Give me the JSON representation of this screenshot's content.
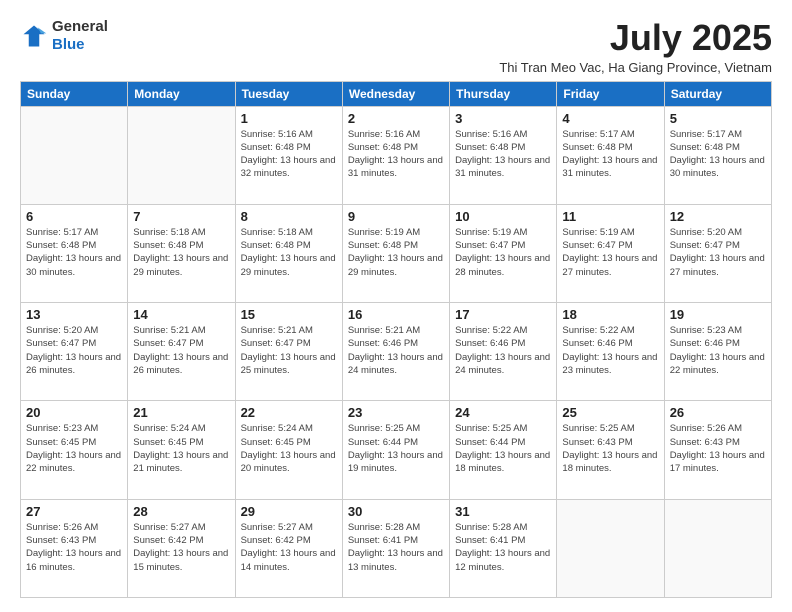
{
  "header": {
    "logo_line1": "General",
    "logo_line2": "Blue",
    "month_title": "July 2025",
    "location": "Thi Tran Meo Vac, Ha Giang Province, Vietnam"
  },
  "days_of_week": [
    "Sunday",
    "Monday",
    "Tuesday",
    "Wednesday",
    "Thursday",
    "Friday",
    "Saturday"
  ],
  "weeks": [
    [
      {
        "day": "",
        "info": ""
      },
      {
        "day": "",
        "info": ""
      },
      {
        "day": "1",
        "info": "Sunrise: 5:16 AM\nSunset: 6:48 PM\nDaylight: 13 hours and 32 minutes."
      },
      {
        "day": "2",
        "info": "Sunrise: 5:16 AM\nSunset: 6:48 PM\nDaylight: 13 hours and 31 minutes."
      },
      {
        "day": "3",
        "info": "Sunrise: 5:16 AM\nSunset: 6:48 PM\nDaylight: 13 hours and 31 minutes."
      },
      {
        "day": "4",
        "info": "Sunrise: 5:17 AM\nSunset: 6:48 PM\nDaylight: 13 hours and 31 minutes."
      },
      {
        "day": "5",
        "info": "Sunrise: 5:17 AM\nSunset: 6:48 PM\nDaylight: 13 hours and 30 minutes."
      }
    ],
    [
      {
        "day": "6",
        "info": "Sunrise: 5:17 AM\nSunset: 6:48 PM\nDaylight: 13 hours and 30 minutes."
      },
      {
        "day": "7",
        "info": "Sunrise: 5:18 AM\nSunset: 6:48 PM\nDaylight: 13 hours and 29 minutes."
      },
      {
        "day": "8",
        "info": "Sunrise: 5:18 AM\nSunset: 6:48 PM\nDaylight: 13 hours and 29 minutes."
      },
      {
        "day": "9",
        "info": "Sunrise: 5:19 AM\nSunset: 6:48 PM\nDaylight: 13 hours and 29 minutes."
      },
      {
        "day": "10",
        "info": "Sunrise: 5:19 AM\nSunset: 6:47 PM\nDaylight: 13 hours and 28 minutes."
      },
      {
        "day": "11",
        "info": "Sunrise: 5:19 AM\nSunset: 6:47 PM\nDaylight: 13 hours and 27 minutes."
      },
      {
        "day": "12",
        "info": "Sunrise: 5:20 AM\nSunset: 6:47 PM\nDaylight: 13 hours and 27 minutes."
      }
    ],
    [
      {
        "day": "13",
        "info": "Sunrise: 5:20 AM\nSunset: 6:47 PM\nDaylight: 13 hours and 26 minutes."
      },
      {
        "day": "14",
        "info": "Sunrise: 5:21 AM\nSunset: 6:47 PM\nDaylight: 13 hours and 26 minutes."
      },
      {
        "day": "15",
        "info": "Sunrise: 5:21 AM\nSunset: 6:47 PM\nDaylight: 13 hours and 25 minutes."
      },
      {
        "day": "16",
        "info": "Sunrise: 5:21 AM\nSunset: 6:46 PM\nDaylight: 13 hours and 24 minutes."
      },
      {
        "day": "17",
        "info": "Sunrise: 5:22 AM\nSunset: 6:46 PM\nDaylight: 13 hours and 24 minutes."
      },
      {
        "day": "18",
        "info": "Sunrise: 5:22 AM\nSunset: 6:46 PM\nDaylight: 13 hours and 23 minutes."
      },
      {
        "day": "19",
        "info": "Sunrise: 5:23 AM\nSunset: 6:46 PM\nDaylight: 13 hours and 22 minutes."
      }
    ],
    [
      {
        "day": "20",
        "info": "Sunrise: 5:23 AM\nSunset: 6:45 PM\nDaylight: 13 hours and 22 minutes."
      },
      {
        "day": "21",
        "info": "Sunrise: 5:24 AM\nSunset: 6:45 PM\nDaylight: 13 hours and 21 minutes."
      },
      {
        "day": "22",
        "info": "Sunrise: 5:24 AM\nSunset: 6:45 PM\nDaylight: 13 hours and 20 minutes."
      },
      {
        "day": "23",
        "info": "Sunrise: 5:25 AM\nSunset: 6:44 PM\nDaylight: 13 hours and 19 minutes."
      },
      {
        "day": "24",
        "info": "Sunrise: 5:25 AM\nSunset: 6:44 PM\nDaylight: 13 hours and 18 minutes."
      },
      {
        "day": "25",
        "info": "Sunrise: 5:25 AM\nSunset: 6:43 PM\nDaylight: 13 hours and 18 minutes."
      },
      {
        "day": "26",
        "info": "Sunrise: 5:26 AM\nSunset: 6:43 PM\nDaylight: 13 hours and 17 minutes."
      }
    ],
    [
      {
        "day": "27",
        "info": "Sunrise: 5:26 AM\nSunset: 6:43 PM\nDaylight: 13 hours and 16 minutes."
      },
      {
        "day": "28",
        "info": "Sunrise: 5:27 AM\nSunset: 6:42 PM\nDaylight: 13 hours and 15 minutes."
      },
      {
        "day": "29",
        "info": "Sunrise: 5:27 AM\nSunset: 6:42 PM\nDaylight: 13 hours and 14 minutes."
      },
      {
        "day": "30",
        "info": "Sunrise: 5:28 AM\nSunset: 6:41 PM\nDaylight: 13 hours and 13 minutes."
      },
      {
        "day": "31",
        "info": "Sunrise: 5:28 AM\nSunset: 6:41 PM\nDaylight: 13 hours and 12 minutes."
      },
      {
        "day": "",
        "info": ""
      },
      {
        "day": "",
        "info": ""
      }
    ]
  ]
}
